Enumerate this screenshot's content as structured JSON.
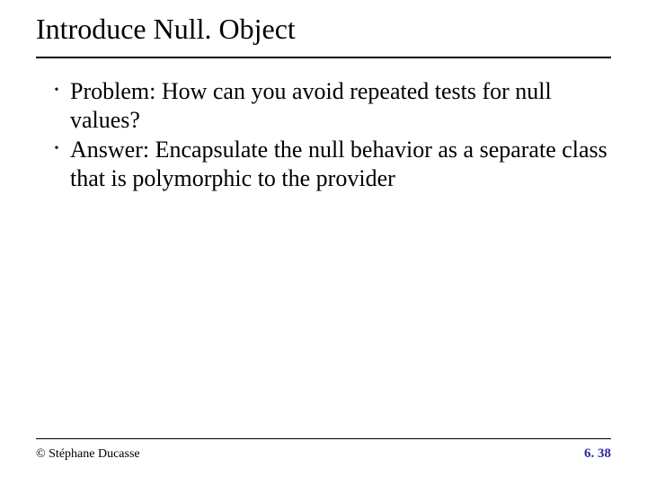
{
  "title": "Introduce Null. Object",
  "bullets": [
    "Problem: How can you avoid repeated tests for null values?",
    "Answer: Encapsulate the null behavior as a separate class that is polymorphic to the provider"
  ],
  "footer": {
    "copyright": "© Stéphane Ducasse",
    "page": "6. 38"
  }
}
